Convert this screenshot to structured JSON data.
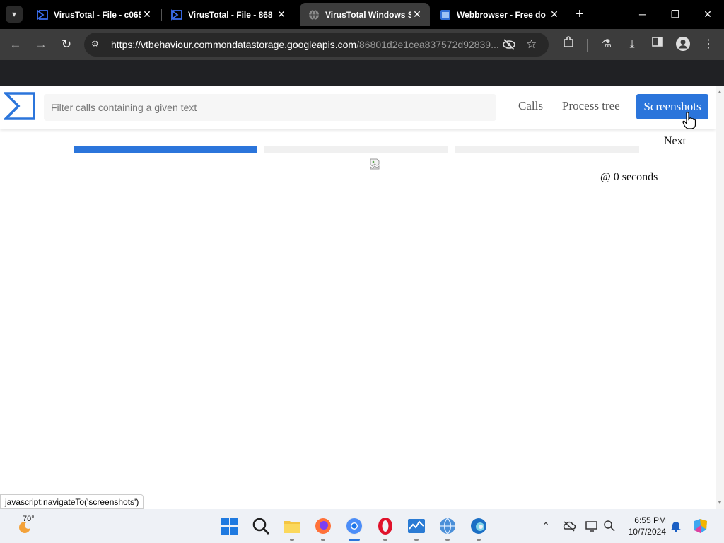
{
  "browser": {
    "tabs": [
      {
        "title": "VirusTotal - File - c065",
        "active": false
      },
      {
        "title": "VirusTotal - File - 868",
        "active": false
      },
      {
        "title": "VirusTotal Windows S",
        "active": true
      },
      {
        "title": "Webbrowser - Free do",
        "active": false
      }
    ],
    "url_host": "https://vtbehaviour.commondatastorage.googleapis.com",
    "url_path": "/86801d2e1cea837572d92839..."
  },
  "vt": {
    "filter_placeholder": "Filter calls containing a given text",
    "nav": {
      "calls": "Calls",
      "process_tree": "Process tree",
      "screenshots": "Screenshots"
    },
    "next_label": "Next",
    "progress": [
      1,
      0,
      0
    ],
    "timestamp": "@ 0 seconds",
    "accent_color": "#2b75db"
  },
  "status_url": "javascript:navigateTo('screenshots')",
  "taskbar": {
    "temperature": "70°",
    "time": "6:55 PM",
    "date": "10/7/2024"
  }
}
